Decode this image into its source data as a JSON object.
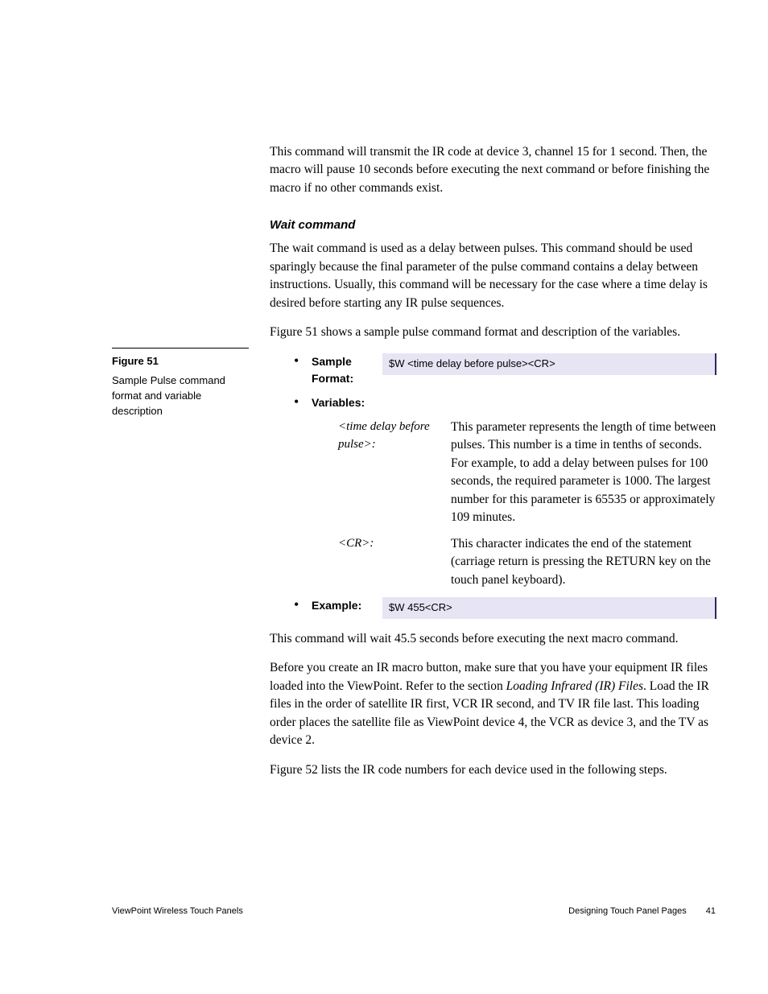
{
  "intro_p": "This command will transmit the IR code at device 3, channel 15 for 1 second. Then, the macro will pause 10 seconds before executing the next command or before finishing the macro if no other commands exist.",
  "section_head": "Wait command",
  "wait_p1": "The wait command is used as a delay between pulses. This command should be used sparingly because the final parameter of the pulse command contains a delay between instructions. Usually, this command will be necessary for the case where a time delay is desired before starting any IR pulse sequences.",
  "wait_p2": "Figure 51 shows a sample pulse command format and description of the variables.",
  "side": {
    "fig_label": "Figure 51",
    "fig_desc": "Sample Pulse command format and variable description"
  },
  "bullets": {
    "sample_format_label": "Sample Format:",
    "sample_format_code": "$W <time delay before pulse><CR>",
    "variables_label": "Variables:",
    "example_label": "Example:",
    "example_code": "$W 455<CR>"
  },
  "vars": {
    "v1_name": "<time delay before pulse>",
    "v1_desc": "This parameter represents the length of time between pulses. This number is a time in tenths of seconds. For example, to add a delay between pulses for 100 seconds, the required parameter is 1000. The largest number for this parameter is 65535 or approximately 109 minutes.",
    "v2_name": "<CR>",
    "v2_desc": "This character indicates the end of the statement (carriage return is pressing the RETURN key on the touch panel keyboard)."
  },
  "after_p1": "This command will wait 45.5 seconds before executing the next macro command.",
  "after_p2a": "Before you create an IR macro button, make sure that you have your equipment IR files loaded into the ViewPoint. Refer to the section ",
  "after_p2_italic": "Loading Infrared (IR) Files",
  "after_p2b": ". Load the IR files in the order of satellite IR first, VCR IR second, and TV IR file last. This loading order places the satellite file as ViewPoint device 4, the VCR as device 3, and the TV as device 2.",
  "after_p3": "Figure 52 lists the IR code numbers for each device used in the following steps.",
  "footer": {
    "left": "ViewPoint Wireless Touch Panels",
    "right_title": "Designing Touch Panel Pages",
    "page_num": "41"
  }
}
